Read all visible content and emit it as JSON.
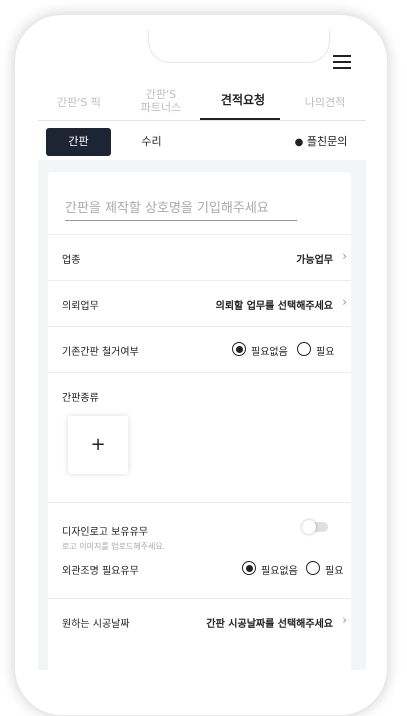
{
  "tabs": [
    "간판'S 픽",
    "간판'S 파트너스",
    "견적요청",
    "나의견적"
  ],
  "active_tab": "견적요청",
  "subnav": {
    "sign_label": "간판",
    "repair_label": "수리",
    "chat_label": "플친문의"
  },
  "form": {
    "name_placeholder": "간판을 제작할 상호명을 기입해주세요",
    "industry_label": "업종",
    "industry_value": "가능업무",
    "request_label": "의뢰업무",
    "request_value": "의뢰할 업무를 선택해주세요",
    "removal_label": "기존간판 철거여부",
    "option_none": "필요없음",
    "option_need": "필요",
    "sign_type_label": "간판종류",
    "add_label": "+",
    "logo_label": "디자인로고 보유유무",
    "logo_hint": "로고 이미지를 업로드해주세요.",
    "lighting_label": "외관조명 필요유무",
    "date_label": "원하는 시공날짜",
    "date_value": "간판 시공날짜를 선택해주세요"
  },
  "colors": {
    "primary": "#1d2433",
    "background": "#f4f5f7"
  },
  "icons": {
    "menu": "hamburger-icon",
    "chat": "speech-bubble-icon",
    "chevron": "chevron-right-icon",
    "add": "plus-icon"
  }
}
